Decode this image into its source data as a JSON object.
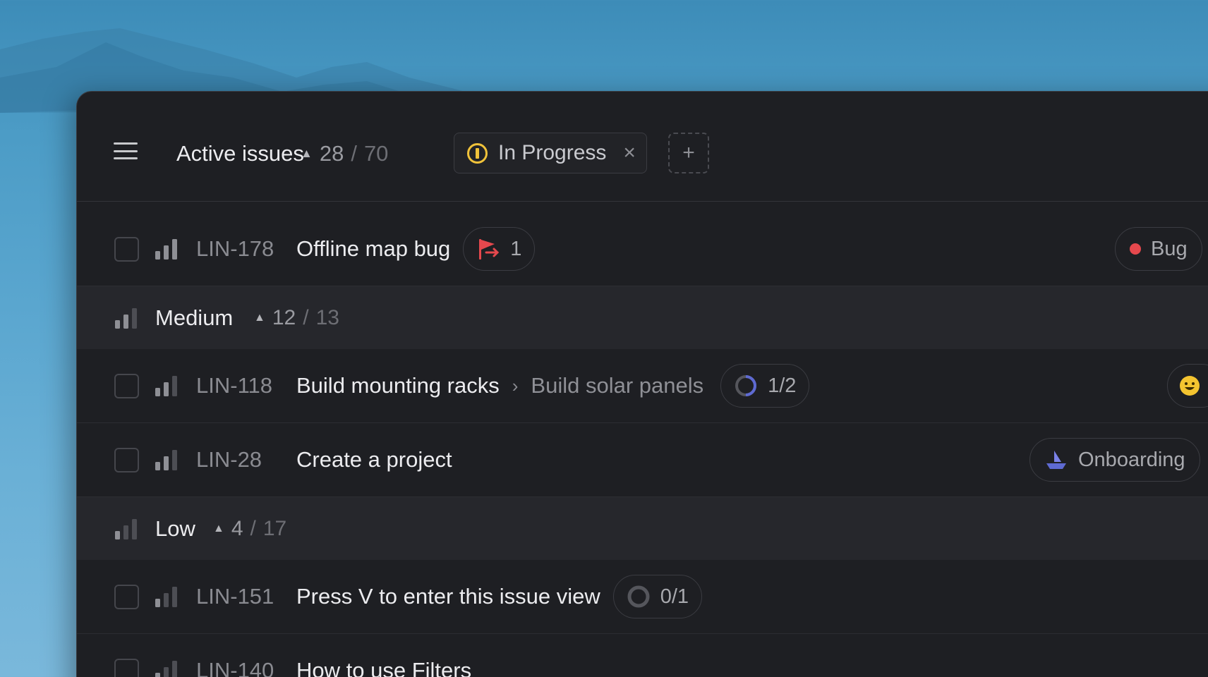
{
  "header": {
    "menu_icon": "menu-icon",
    "title": "Active issues",
    "count_done": "28",
    "count_sep": "/",
    "count_total": "70",
    "filter": {
      "label": "In Progress",
      "status_icon": "in-progress-icon",
      "status_color": "#f0c23a",
      "close_glyph": "×"
    },
    "add_filter_glyph": "+"
  },
  "rows": [
    {
      "kind": "issue",
      "id": "LIN-178",
      "title": "Offline map bug",
      "pill_icon": "red-flag-icon",
      "pill_value": "1",
      "label": "Bug",
      "label_color": "#e5484d"
    },
    {
      "kind": "group",
      "name": "Medium",
      "count_done": "12",
      "count_sep": "/",
      "count_total": "13"
    },
    {
      "kind": "issue",
      "id": "LIN-118",
      "title": "Build mounting racks",
      "breadcrumb_sep": "›",
      "parent": "Build solar panels",
      "pill_icon": "progress-ring-icon",
      "pill_value": "1/2",
      "trailing_icon": "emoji-smile-icon"
    },
    {
      "kind": "issue",
      "id": "LIN-28",
      "title": "Create a project",
      "label_icon": "onboarding-boat-icon",
      "label": "Onboarding"
    },
    {
      "kind": "group",
      "name": "Low",
      "count_done": "4",
      "count_sep": "/",
      "count_total": "17"
    },
    {
      "kind": "issue",
      "id": "LIN-151",
      "title": "Press V to enter this issue view",
      "pill_icon": "empty-ring-icon",
      "pill_value": "0/1"
    },
    {
      "kind": "issue",
      "id": "LIN-140",
      "title": "How to use Filters"
    }
  ],
  "colors": {
    "accent_bug": "#e5484d",
    "accent_progress": "#5e6ad2",
    "window_bg": "#1e1f23",
    "group_bg": "#26272c"
  }
}
